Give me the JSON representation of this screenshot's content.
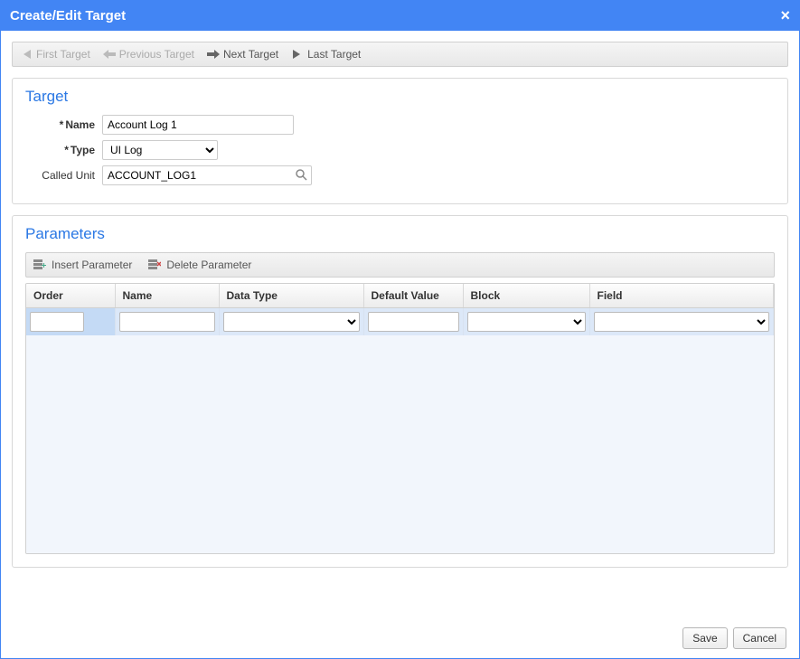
{
  "dialog": {
    "title": "Create/Edit Target"
  },
  "nav": {
    "first": "First Target",
    "prev": "Previous Target",
    "next": "Next Target",
    "last": "Last Target"
  },
  "target": {
    "section_title": "Target",
    "labels": {
      "name": "Name",
      "type": "Type",
      "called_unit": "Called Unit"
    },
    "name_value": "Account Log 1",
    "type_value": "UI Log",
    "called_unit_value": "ACCOUNT_LOG1"
  },
  "parameters": {
    "section_title": "Parameters",
    "toolbar": {
      "insert": "Insert Parameter",
      "delete": "Delete Parameter"
    },
    "columns": {
      "order": "Order",
      "name": "Name",
      "data_type": "Data Type",
      "default_value": "Default Value",
      "block": "Block",
      "field": "Field"
    },
    "row": {
      "order": "",
      "name": "",
      "data_type": "",
      "default_value": "",
      "block": "",
      "field": ""
    }
  },
  "footer": {
    "save": "Save",
    "cancel": "Cancel"
  }
}
